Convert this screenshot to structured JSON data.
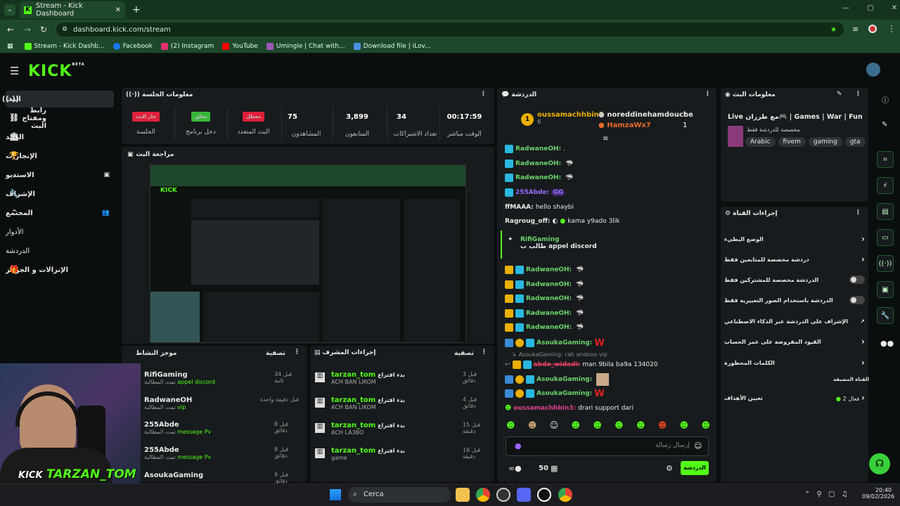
{
  "browser": {
    "tab_title": "Stream - Kick Dashboard",
    "url": "dashboard.kick.com/stream",
    "bookmarks": [
      {
        "label": "Stream - Kick Dashb...",
        "color": "#53fc18"
      },
      {
        "label": "Facebook",
        "color": "#1877f2"
      },
      {
        "label": "(2) Instagram",
        "color": "#e1306c"
      },
      {
        "label": "YouTube",
        "color": "#ff0000"
      },
      {
        "label": "Umingle | Chat with...",
        "color": "#9b59b6"
      },
      {
        "label": "Download file | iLov...",
        "color": "#4a90e2"
      }
    ]
  },
  "kick": {
    "logo": "KICK",
    "beta": "BETA",
    "sidebar": [
      {
        "label": "البث",
        "icon": "live-icon",
        "active": true
      },
      {
        "label": "رابط ومفتاح البث",
        "icon": "link-icon"
      },
      {
        "label": "العائد",
        "icon": "bank-icon"
      },
      {
        "label": "الإنجازات",
        "icon": "trophy-icon"
      },
      {
        "label": "الاستديو",
        "icon": "chevron-down-icon"
      },
      {
        "label": "الإشراف",
        "icon": "wrench-icon"
      },
      {
        "label": "المجتمع",
        "icon": "chevron-up-icon"
      },
      {
        "label": "الأدوار",
        "icon": ""
      },
      {
        "label": "الدردشة",
        "icon": ""
      },
      {
        "label": "الإنزالات و الجوائز",
        "icon": "gift-icon"
      }
    ]
  },
  "session": {
    "title": "معلومات الجلسة",
    "stats": [
      {
        "value": "00:17:59",
        "label": "الوقت مباشر"
      },
      {
        "value": "34",
        "label": "تعداد الاشتراكات"
      },
      {
        "value": "3,899",
        "label": "المتابعون"
      },
      {
        "value": "75",
        "label": "المشاهدون"
      },
      {
        "pill": "معطل",
        "pill_color": "#e0203a",
        "label": "البث المتعدد"
      },
      {
        "pill": "مغلق",
        "pill_color": "#38b83a",
        "label": "دخل برنامج"
      },
      {
        "pill": "جار البث",
        "pill_color": "#e0203a",
        "label": "الجلسة"
      }
    ]
  },
  "preview": {
    "title": "مراجعة البث"
  },
  "chat": {
    "title": "الدردشة",
    "top": [
      {
        "name": "oussamachhbin3",
        "count": "6"
      },
      {
        "name": "noreddinehamdouche",
        "count": "1"
      },
      {
        "name": "HamzaWx7",
        "count": "1"
      }
    ],
    "messages": [
      {
        "user": "RadwaneOH:",
        "text": ".",
        "color": "#6cd46c"
      },
      {
        "user": "RadwaneOH:",
        "text": "",
        "color": "#6cd46c"
      },
      {
        "user": "RadwaneOH:",
        "text": "",
        "color": "#6cd46c"
      },
      {
        "user": "255Abde:",
        "text": "GG",
        "color": "#9b6bff"
      },
      {
        "user": "ffMAAA:",
        "text": "hello shaybi",
        "color": "#ffffff"
      },
      {
        "user": "Ragroug_off:",
        "text": "kama y9ado 3lik",
        "color": "#ffffff"
      },
      {
        "user": "RifiGaming",
        "text": "طالب ب appel discord",
        "color": "#6cd46c"
      },
      {
        "user": "RadwaneOH:",
        "text": "",
        "color": "#6cd46c"
      },
      {
        "user": "RadwaneOH:",
        "text": "",
        "color": "#6cd46c"
      },
      {
        "user": "RadwaneOH:",
        "text": "",
        "color": "#6cd46c"
      },
      {
        "user": "RadwaneOH:",
        "text": "",
        "color": "#6cd46c"
      },
      {
        "user": "RadwaneOH:",
        "text": "",
        "color": "#6cd46c"
      },
      {
        "user": "AsoukaGaming:",
        "text": "W",
        "color": "#6cd46c"
      },
      {
        "user": "AsoukaGaming:",
        "text": "rah andooo vip",
        "color": "#888888"
      },
      {
        "user": "abdo_widadi:",
        "text": "man 9bila ba9a 134020",
        "color": "#e04060"
      },
      {
        "user": "AsoukaGaming:",
        "text": "",
        "color": "#6cd46c"
      },
      {
        "user": "AsoukaGaming:",
        "text": "W",
        "color": "#6cd46c"
      },
      {
        "user": "oussamachhbin3:",
        "text": "drari support dari",
        "color": "#e04090"
      }
    ],
    "input_placeholder": "إرسال رسالة",
    "points": "50",
    "send_label": "الدردشة"
  },
  "activity": {
    "title": "موجز النشاط",
    "filter": "تصفية",
    "items": [
      {
        "user": "RifiGaming",
        "sub": "تمت المطالبة",
        "reward": "appel discord",
        "time": "قبل 34 ثانية"
      },
      {
        "user": "RadwaneOH",
        "sub": "تمت المطالبة",
        "reward": "vip",
        "time": "قبل دقيقة واحدة"
      },
      {
        "user": "255Abde",
        "sub": "تمت المطالبة",
        "reward": "message Pv",
        "time": "قبل 8 دقائق"
      },
      {
        "user": "255Abde",
        "sub": "تمت المطالبة",
        "reward": "message Pv",
        "time": "قبل 8 دقائق"
      },
      {
        "user": "AsoukaGaming",
        "sub": "",
        "reward": "",
        "time": "قبل 9 دقائق"
      }
    ]
  },
  "mod": {
    "title": "إجراءات المشرف",
    "filter": "تصفية",
    "items": [
      {
        "user": "tarzan_tom",
        "action": "بدء اقتراع",
        "detail": "ACH BAN LIKOM",
        "time": "قبل 3 دقائق"
      },
      {
        "user": "tarzan_tom",
        "action": "بدء اقتراع",
        "detail": "ACH BAN LIKOM",
        "time": "قبل 4 دقائق"
      },
      {
        "user": "tarzan_tom",
        "action": "بدء اقتراع",
        "detail": "ACH LA3BO",
        "time": "قبل 15 دقيقة"
      },
      {
        "user": "tarzan_tom",
        "action": "بدء اقتراع",
        "detail": "game",
        "time": "قبل 16 دقيقة"
      }
    ]
  },
  "stream_info": {
    "title": "معلومات البث",
    "stream_title": "Live مع طرزان🎮 | Games | War | Fun 😂",
    "subtitle": "مخصصة للدردشة فقط",
    "tags": [
      "Arabic",
      "fivem",
      "gaming",
      "gta"
    ]
  },
  "channel_actions": {
    "title": "إجراءات القناة",
    "rows": [
      {
        "label": "الوضع البطيء",
        "control": "chevron"
      },
      {
        "label": "دردشة مخصصة للمتابعين فقط",
        "control": "chevron"
      },
      {
        "label": "الدردشة مخصصة للمشتركين فقط",
        "control": "toggle"
      },
      {
        "label": "الدردشة باستخدام الصور التعبيرية فقط",
        "control": "toggle"
      },
      {
        "label": "الإشراف على الدردشة عبر الذكاء الاصطناعي",
        "control": "external"
      },
      {
        "label": "القيود المفروضة على عمر الحساب",
        "control": "chevron"
      },
      {
        "label": "الكلمات المحظورة",
        "control": "chevron"
      }
    ],
    "guest_title": "القناة المضيفة",
    "goals_label": "تعيين الأهداف",
    "goals_value": "فعال 2"
  },
  "webcam": {
    "overlay_text": "TARZAN_TOM",
    "overlay_brand": "KICK"
  },
  "taskbar": {
    "search": "Cerca",
    "time": "20:40",
    "date": "09/02/2026"
  }
}
